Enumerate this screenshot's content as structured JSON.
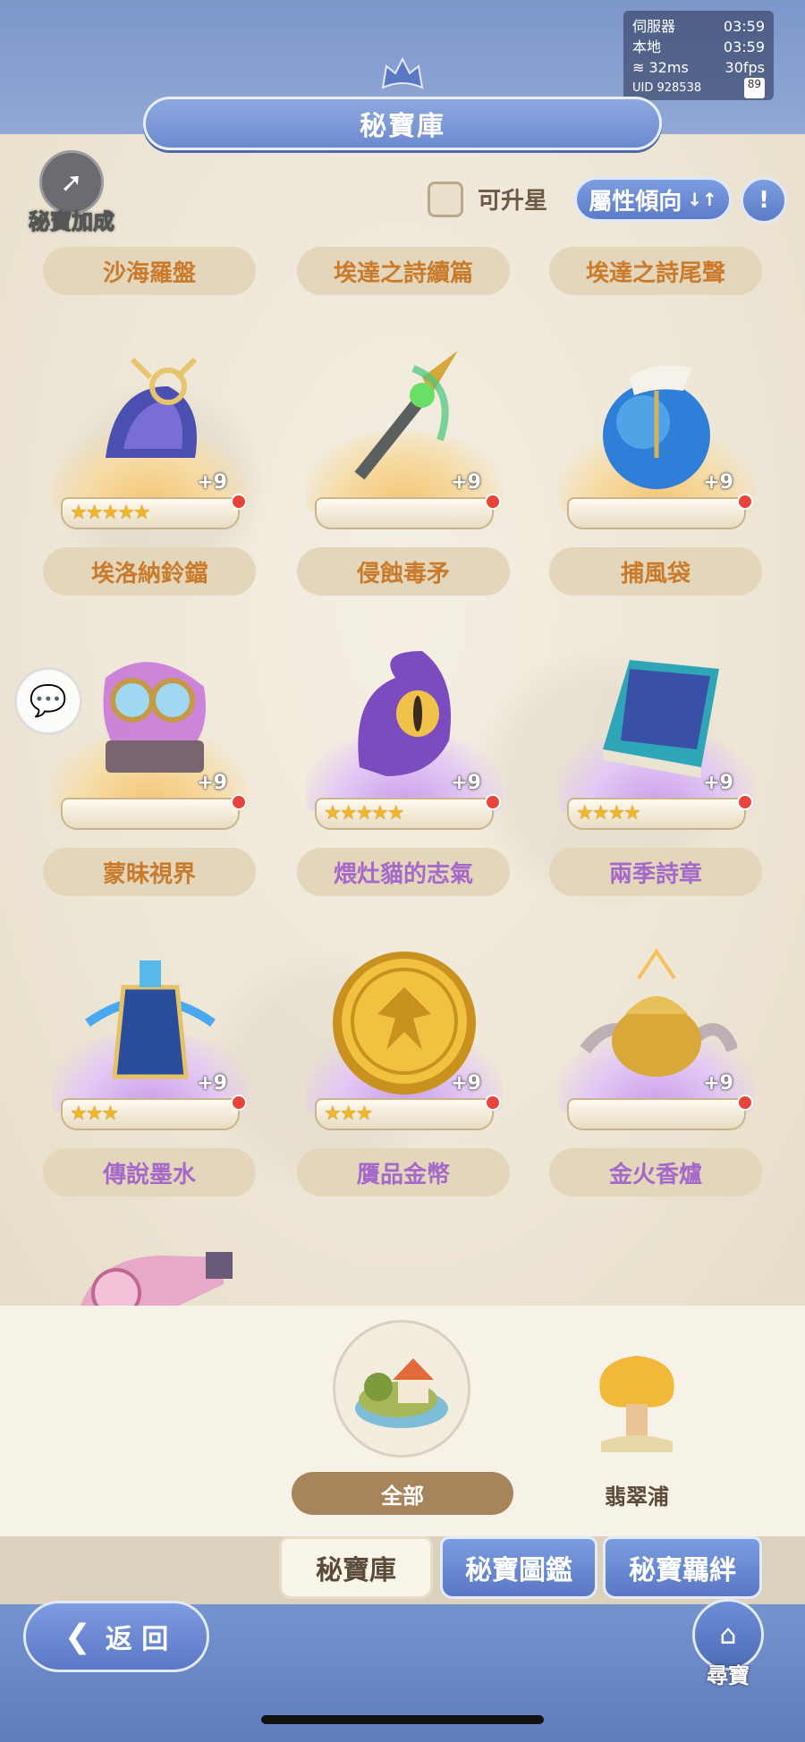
{
  "status": {
    "server_label": "伺服器",
    "server_time": "03:59",
    "local_label": "本地",
    "local_time": "03:59",
    "ping": "32ms",
    "fps": "30fps",
    "uid": "UID 928538",
    "battery": "89"
  },
  "header": {
    "title": "秘寶庫",
    "bonus_label": "秘寶加成"
  },
  "filters": {
    "upgradable_label": "可升星",
    "attribute_button": "屬性傾向",
    "attribute_icon": "↓↑"
  },
  "colors": {
    "orange_label": "#c97b2b",
    "purple_label": "#a569c9",
    "accent": "#6c8ad0"
  },
  "top_labels": [
    "沙海羅盤",
    "埃達之詩續篇",
    "埃達之詩尾聲"
  ],
  "items": [
    {
      "name": "埃洛納鈴鐺",
      "level": "+9",
      "stars": 5,
      "rarity": "gold",
      "label_color": "orange",
      "icon": "bell-icon"
    },
    {
      "name": "侵蝕毒矛",
      "level": "+9",
      "stars": 0,
      "rarity": "gold",
      "label_color": "orange",
      "icon": "spear-icon"
    },
    {
      "name": "捕風袋",
      "level": "+9",
      "stars": 0,
      "rarity": "gold",
      "label_color": "orange",
      "icon": "wind-bag-icon"
    },
    {
      "name": "蒙昧視界",
      "level": "+9",
      "stars": 0,
      "rarity": "gold",
      "label_color": "orange",
      "icon": "goggles-icon"
    },
    {
      "name": "煨灶貓的志氣",
      "level": "+9",
      "stars": 5,
      "rarity": "violet",
      "label_color": "purple",
      "icon": "cat-eye-icon"
    },
    {
      "name": "兩季詩章",
      "level": "+9",
      "stars": 4,
      "rarity": "violet",
      "label_color": "purple",
      "icon": "book-icon"
    },
    {
      "name": "傳說墨水",
      "level": "+9",
      "stars": 3,
      "rarity": "violet",
      "label_color": "purple",
      "icon": "ink-bottle-icon"
    },
    {
      "name": "贋品金幣",
      "level": "+9",
      "stars": 3,
      "rarity": "violet",
      "label_color": "purple",
      "icon": "gold-coin-icon"
    },
    {
      "name": "金火香爐",
      "level": "+9",
      "stars": 0,
      "rarity": "violet",
      "label_color": "purple",
      "icon": "censer-icon"
    }
  ],
  "regions": {
    "all_label": "全部",
    "fcp_label": "翡翠浦"
  },
  "tabs": [
    "秘寶庫",
    "秘寶圖鑑",
    "秘寶羈絆"
  ],
  "footer": {
    "back_label": "返 回",
    "hunt_label": "尋寶"
  }
}
